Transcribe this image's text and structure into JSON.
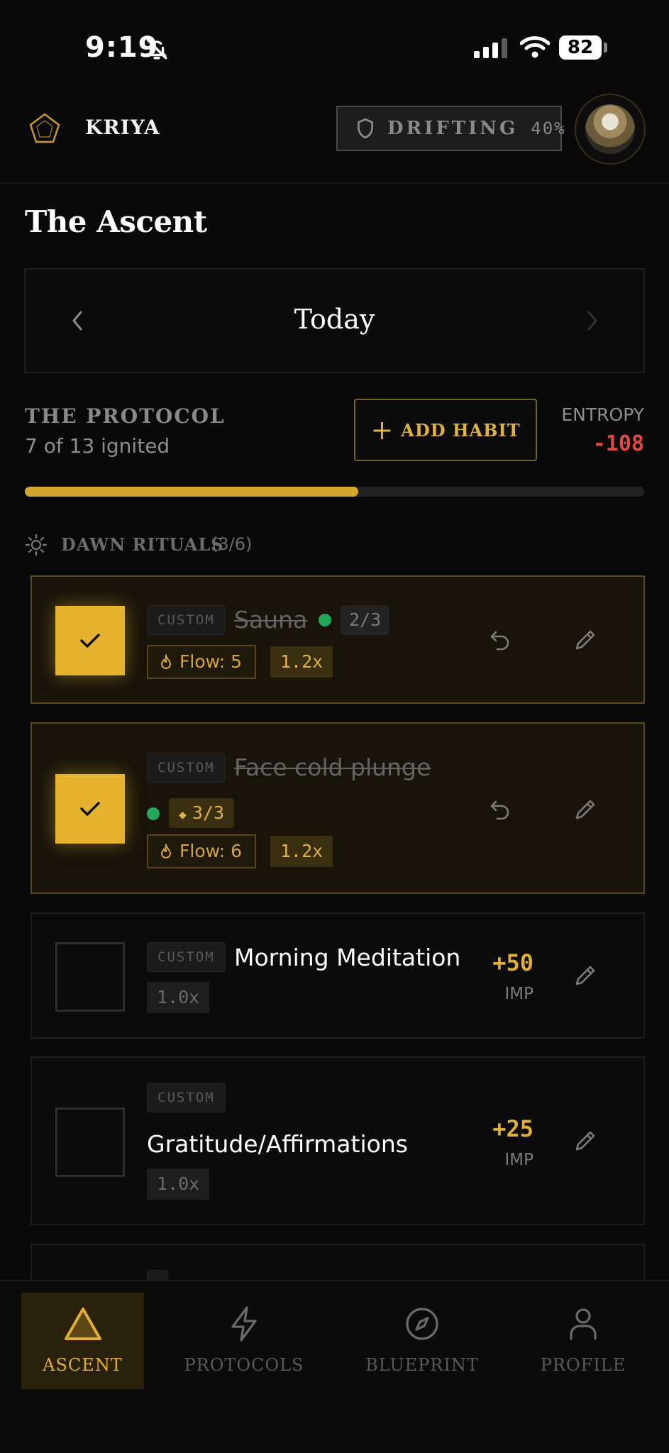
{
  "status_bar": {
    "time": "9:19",
    "battery": "82"
  },
  "header": {
    "brand": "KRIYA",
    "status_badge": {
      "label": "DRIFTING",
      "percent": "40%"
    }
  },
  "page": {
    "title": "The Ascent"
  },
  "date_nav": {
    "label": "Today"
  },
  "protocol": {
    "title": "THE PROTOCOL",
    "subtitle": "7 of 13 ignited",
    "add_habit_label": "ADD HABIT",
    "entropy_label": "ENTROPY",
    "entropy_value": "-108",
    "progress_fraction": 0.5385
  },
  "section": {
    "title": "DAWN RITUALS",
    "count": "(3/6)"
  },
  "habits": [
    {
      "tag": "CUSTOM",
      "name": "Sauna",
      "completed": true,
      "progress": "2/3",
      "flow": "Flow: 5",
      "multiplier": "1.2x"
    },
    {
      "tag": "CUSTOM",
      "name": "Face cold plunge",
      "completed": true,
      "progress": "3/3",
      "flow": "Flow: 6",
      "multiplier": "1.2x"
    },
    {
      "tag": "CUSTOM",
      "name": "Morning Meditation",
      "completed": false,
      "multiplier": "1.0x",
      "points": "+50",
      "points_unit": "IMP"
    },
    {
      "tag": "CUSTOM",
      "name": "Gratitude/Affirmations",
      "completed": false,
      "multiplier": "1.0x",
      "points": "+25",
      "points_unit": "IMP"
    }
  ],
  "bottom_nav": {
    "items": [
      {
        "label": "ASCENT",
        "icon": "triangle-icon",
        "active": true
      },
      {
        "label": "PROTOCOLS",
        "icon": "lightning-icon",
        "active": false
      },
      {
        "label": "BLUEPRINT",
        "icon": "compass-icon",
        "active": false
      },
      {
        "label": "PROFILE",
        "icon": "user-icon",
        "active": false
      }
    ]
  },
  "colors": {
    "accent": "#E6B32E",
    "success": "#22A858",
    "danger": "#E14A40",
    "background": "#090909"
  }
}
